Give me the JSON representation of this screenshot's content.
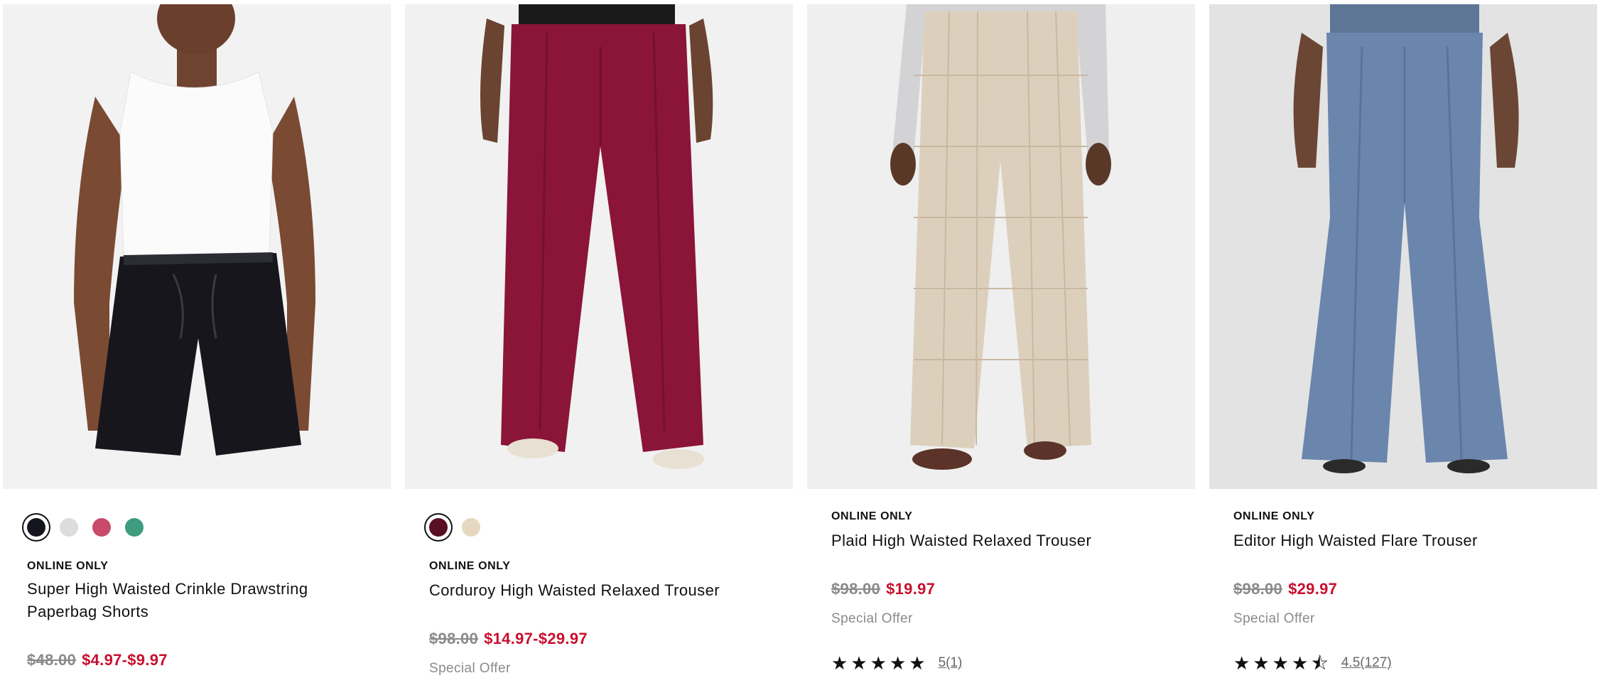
{
  "products": [
    {
      "badge": "ONLINE ONLY",
      "title": "Super High Waisted Crinkle Drawstring Paperbag Shorts",
      "price_original": "$48.00",
      "price_sale": "$4.97-$9.97",
      "swatches": [
        "#14151f",
        "#dcdcdc",
        "#c94a6a",
        "#3f9c7e"
      ]
    },
    {
      "badge": "ONLINE ONLY",
      "title": "Corduroy High Waisted Relaxed Trouser",
      "price_original": "$98.00",
      "price_sale": "$14.97-$29.97",
      "offer": "Special Offer",
      "swatches": [
        "#5a1024",
        "#e6d8c0"
      ]
    },
    {
      "badge": "ONLINE ONLY",
      "title": "Plaid High Waisted Relaxed Trouser",
      "price_original": "$98.00",
      "price_sale": "$19.97",
      "offer": "Special Offer",
      "rating": 5,
      "rating_text": "5(1)"
    },
    {
      "badge": "ONLINE ONLY",
      "title": "Editor High Waisted Flare Trouser",
      "price_original": "$98.00",
      "price_sale": "$29.97",
      "offer": "Special Offer",
      "rating": 4.5,
      "rating_text": "4.5(127)"
    }
  ],
  "colors": {
    "sale": "#c8102e",
    "muted": "#8a8a8a"
  }
}
